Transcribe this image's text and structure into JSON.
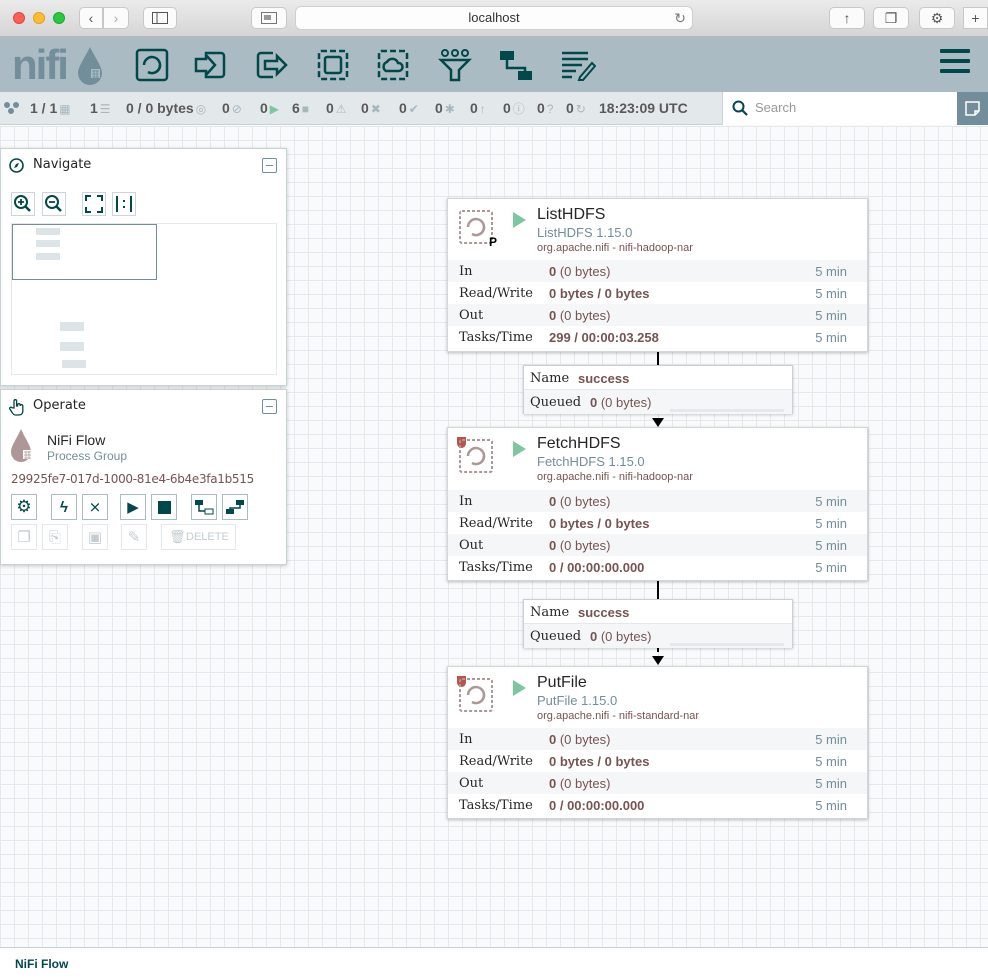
{
  "browser": {
    "url": "localhost"
  },
  "header": {
    "logo_text": "nifi",
    "tools": [
      "processor",
      "input-port",
      "output-port",
      "process-group",
      "remote-process-group",
      "funnel",
      "template",
      "label"
    ]
  },
  "status": {
    "clustered": "1 / 1",
    "threads": "1",
    "queued": "0 / 0 bytes",
    "transmitting": "0",
    "not_transmitting": "0",
    "running": "0",
    "stopped": "6",
    "invalid": "0",
    "disabled": "0",
    "up_to_date": "0",
    "locally_modified": "0",
    "stale": "0",
    "locally_modified_stale": "0",
    "sync_failure": "0",
    "last_refreshed": "18:23:09 UTC"
  },
  "search": {
    "placeholder": "Search"
  },
  "navigate": {
    "title": "Navigate"
  },
  "operate": {
    "title": "Operate",
    "name": "NiFi Flow",
    "type": "Process Group",
    "id": "29925fe7-017d-1000-81e4-6b4e3fa1b515",
    "delete_label": "DELETE"
  },
  "processors": [
    {
      "name": "ListHDFS",
      "version": "ListHDFS 1.15.0",
      "bundle": "org.apache.nifi - nifi-hadoop-nar",
      "flag": "P",
      "rows": [
        {
          "label": "In",
          "bold": "0",
          "rest": " (0 bytes)",
          "time": "5 min"
        },
        {
          "label": "Read/Write",
          "bold": "0 bytes / 0 bytes",
          "rest": "",
          "time": "5 min"
        },
        {
          "label": "Out",
          "bold": "0",
          "rest": " (0 bytes)",
          "time": "5 min"
        },
        {
          "label": "Tasks/Time",
          "bold": "299 / 00:00:03.258",
          "rest": "",
          "time": "5 min"
        }
      ]
    },
    {
      "name": "FetchHDFS",
      "version": "FetchHDFS 1.15.0",
      "bundle": "org.apache.nifi - nifi-hadoop-nar",
      "flag": "",
      "rows": [
        {
          "label": "In",
          "bold": "0",
          "rest": " (0 bytes)",
          "time": "5 min"
        },
        {
          "label": "Read/Write",
          "bold": "0 bytes / 0 bytes",
          "rest": "",
          "time": "5 min"
        },
        {
          "label": "Out",
          "bold": "0",
          "rest": " (0 bytes)",
          "time": "5 min"
        },
        {
          "label": "Tasks/Time",
          "bold": "0 / 00:00:00.000",
          "rest": "",
          "time": "5 min"
        }
      ]
    },
    {
      "name": "PutFile",
      "version": "PutFile 1.15.0",
      "bundle": "org.apache.nifi - nifi-standard-nar",
      "flag": "",
      "rows": [
        {
          "label": "In",
          "bold": "0",
          "rest": " (0 bytes)",
          "time": "5 min"
        },
        {
          "label": "Read/Write",
          "bold": "0 bytes / 0 bytes",
          "rest": "",
          "time": "5 min"
        },
        {
          "label": "Out",
          "bold": "0",
          "rest": " (0 bytes)",
          "time": "5 min"
        },
        {
          "label": "Tasks/Time",
          "bold": "0 / 00:00:00.000",
          "rest": "",
          "time": "5 min"
        }
      ]
    }
  ],
  "connections": [
    {
      "name_label": "Name",
      "name": "success",
      "queued_label": "Queued",
      "queued_bold": "0",
      "queued_rest": " (0 bytes)"
    },
    {
      "name_label": "Name",
      "name": "success",
      "queued_label": "Queued",
      "queued_bold": "0",
      "queued_rest": " (0 bytes)"
    }
  ],
  "breadcrumb": {
    "label": "NiFi Flow"
  },
  "colors": {
    "header": "#aabbc3",
    "accent": "#004849",
    "value": "#775351",
    "muted": "#728e9b",
    "run": "#7dc7a0",
    "invalid": "#ba554a"
  }
}
